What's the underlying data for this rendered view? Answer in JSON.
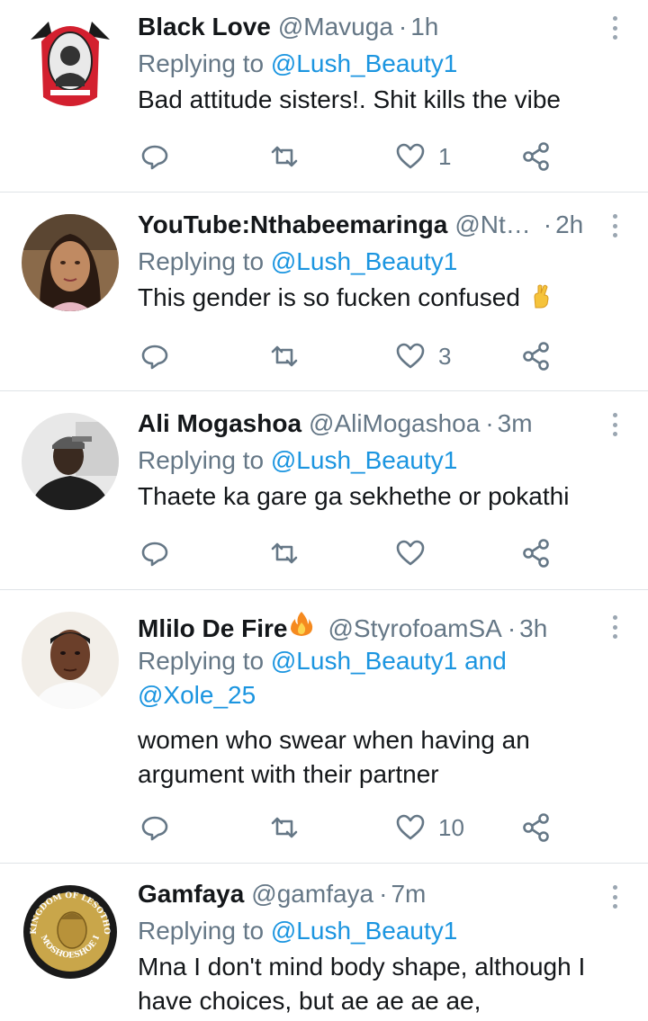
{
  "colors": {
    "accent": "#1b95e0",
    "secondary_text": "#657786",
    "divider": "#dfe3e7"
  },
  "tweets": [
    {
      "name": "Black Love",
      "handle": "@Mavuga",
      "time": "1h",
      "reply_prefix": "Replying to",
      "mention": "@Lush_Beauty1",
      "text": "Bad attitude sisters!. Shit kills the vibe",
      "likes": "1",
      "avatar": "red-crest-avatar"
    },
    {
      "name": "YouTube:Nthabeemaringa",
      "handle": "@Nt…",
      "time": "2h",
      "reply_prefix": "Replying to",
      "mention": "@Lush_Beauty1",
      "text": "This gender is so fucken confused",
      "emoji": "crossed-fingers-emoji",
      "likes": "3",
      "avatar": "woman-portrait-avatar"
    },
    {
      "name": "Ali Mogashoa",
      "handle": "@AliMogashoa",
      "time": "3m",
      "reply_prefix": "Replying to",
      "mention": "@Lush_Beauty1",
      "text": "Thaete ka gare ga sekhethe or pokathi",
      "likes": "",
      "avatar": "man-cap-avatar"
    },
    {
      "name": "Mlilo De Fire",
      "name_emoji": "fire-emoji",
      "handle": "@StyrofoamSA",
      "time": "3h",
      "reply_prefix": "Replying to",
      "mention": "@Lush_Beauty1 and",
      "mention2": "@Xole_25",
      "text1": "women who swear when having an",
      "text2": "argument with their partner",
      "likes": "10",
      "avatar": "man-portrait-avatar"
    },
    {
      "name": "Gamfaya",
      "handle": "@gamfaya",
      "time": "7m",
      "reply_prefix": "Replying to",
      "mention": "@Lush_Beauty1",
      "text1": "Mna I don't mind body shape, although I",
      "text2": "have choices, but ae ae ae ae,",
      "avatar": "lesotho-coin-avatar",
      "coin_text_top": "KINGDOM OF LESOTHO",
      "coin_text_bottom": "MOSHOESHOE I"
    }
  ],
  "icons": {
    "reply": "reply-icon",
    "retweet": "retweet-icon",
    "like": "heart-icon",
    "share": "share-icon",
    "more": "more-options-icon"
  }
}
